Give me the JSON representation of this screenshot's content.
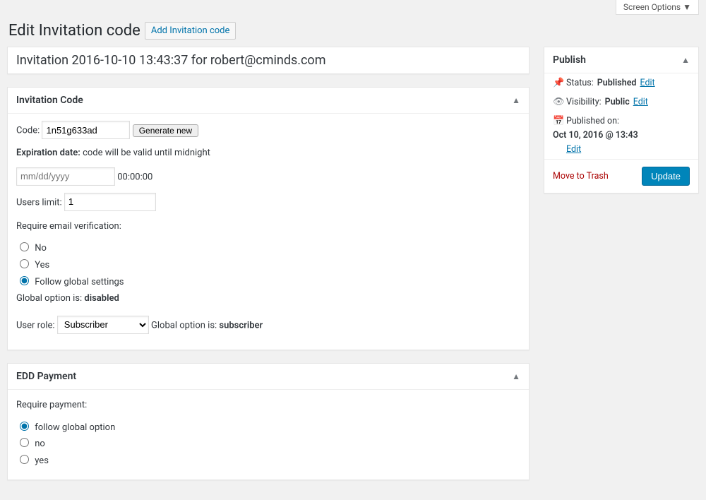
{
  "topbar": {
    "screen_options": "Screen Options"
  },
  "heading": {
    "title": "Edit Invitation code",
    "action": "Add Invitation code"
  },
  "post_title": "Invitation 2016-10-10 13:43:37 for robert@cminds.com",
  "invitation_box": {
    "title": "Invitation Code",
    "code_label": "Code:",
    "code_value": "1n51g633ad",
    "generate": "Generate new",
    "expiration_label": "Expiration date:",
    "expiration_hint": "code will be valid until midnight",
    "date_placeholder": "mm/dd/yyyy",
    "time_hint": "00:00:00",
    "users_limit_label": "Users limit:",
    "users_limit_value": "1",
    "require_verify_label": "Require email verification:",
    "verify_options": {
      "no": "No",
      "yes": "Yes",
      "follow": "Follow global settings"
    },
    "global_verify_text": "Global option is:",
    "global_verify_value": "disabled",
    "user_role_label": "User role:",
    "user_role_selected": "Subscriber",
    "global_role_text": "Global option is:",
    "global_role_value": "subscriber"
  },
  "edd_box": {
    "title": "EDD Payment",
    "require_label": "Require payment:",
    "options": {
      "follow": "follow global option",
      "no": "no",
      "yes": "yes"
    }
  },
  "publish_box": {
    "title": "Publish",
    "status_label": "Status:",
    "status_value": "Published",
    "visibility_label": "Visibility:",
    "visibility_value": "Public",
    "published_label": "Published on:",
    "published_value": "Oct 10, 2016 @ 13:43",
    "edit": "Edit",
    "trash": "Move to Trash",
    "update": "Update"
  }
}
